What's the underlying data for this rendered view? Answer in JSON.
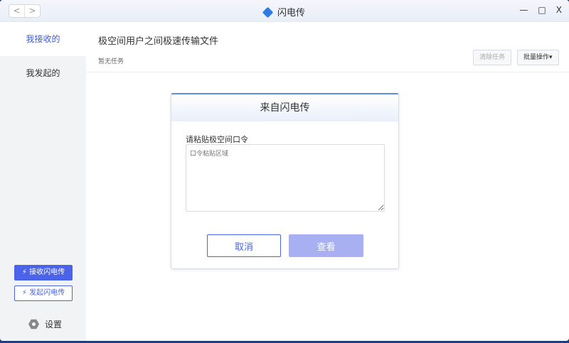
{
  "titlebar": {
    "back": "<",
    "forward": ">",
    "title": "闪电传",
    "minimize": "—",
    "maximize": "□",
    "close": "X"
  },
  "sidebar": {
    "items": [
      {
        "label": "我接收的"
      },
      {
        "label": "我发起的"
      }
    ],
    "receive_button": "接收闪电传",
    "send_button": "发起闪电传",
    "settings": "设置"
  },
  "main": {
    "heading": "极空间用户之间极速传输文件",
    "status": "暂无任务",
    "clear_button": "清除任务",
    "batch_button": "批量操作▾"
  },
  "dialog": {
    "title": "来自闪电传",
    "label": "请粘贴极空间口令",
    "placeholder": "口令粘贴区域",
    "cancel": "取消",
    "view": "查看"
  },
  "colors": {
    "accent": "#4a63e8"
  }
}
